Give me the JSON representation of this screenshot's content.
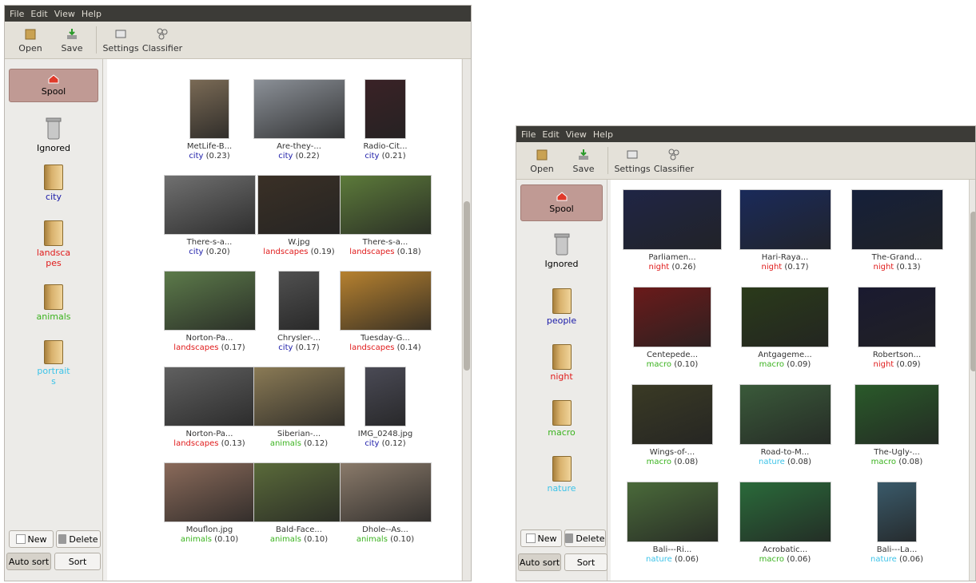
{
  "colors": {
    "city": "#1a1aa8",
    "landscapes": "#e01b1b",
    "animals": "#3bb31f",
    "portraits": "#3cc3e8",
    "people": "#1a1aa8",
    "night": "#e01b1b",
    "macro": "#3bb31f",
    "nature": "#3cc3e8"
  },
  "menu": [
    "File",
    "Edit",
    "View",
    "Help"
  ],
  "toolbar": {
    "open": "Open",
    "save": "Save",
    "settings": "Settings",
    "classifier": "Classifier"
  },
  "buttons": {
    "new": "New",
    "delete": "Delete",
    "auto_sort": "Auto sort",
    "sort": "Sort"
  },
  "left": {
    "sidebar": [
      {
        "label": "Spool",
        "kind": "spool"
      },
      {
        "label": "Ignored",
        "kind": "trash"
      },
      {
        "label": "city",
        "kind": "folder",
        "color": "#1a1aa8"
      },
      {
        "label": "landscapes",
        "kind": "folder",
        "color": "#e01b1b"
      },
      {
        "label": "animals",
        "kind": "folder",
        "color": "#3bb31f"
      },
      {
        "label": "portraits",
        "kind": "folder",
        "color": "#3cc3e8"
      }
    ],
    "items": [
      {
        "name": "MetLife-B...",
        "cat": "city",
        "score": "(0.23)"
      },
      {
        "name": "Are-they-...",
        "cat": "city",
        "score": "(0.22)"
      },
      {
        "name": "Radio-Cit...",
        "cat": "city",
        "score": "(0.21)"
      },
      {
        "name": "There-s-a...",
        "cat": "city",
        "score": "(0.20)"
      },
      {
        "name": "W.jpg",
        "cat": "landscapes",
        "score": "(0.19)"
      },
      {
        "name": "There-s-a...",
        "cat": "landscapes",
        "score": "(0.18)"
      },
      {
        "name": "Norton-Pa...",
        "cat": "landscapes",
        "score": "(0.17)"
      },
      {
        "name": "Chrysler-...",
        "cat": "city",
        "score": "(0.17)"
      },
      {
        "name": "Tuesday-G...",
        "cat": "landscapes",
        "score": "(0.14)"
      },
      {
        "name": "Norton-Pa...",
        "cat": "landscapes",
        "score": "(0.13)"
      },
      {
        "name": "Siberian-...",
        "cat": "animals",
        "score": "(0.12)"
      },
      {
        "name": "IMG_0248.jpg",
        "cat": "city",
        "score": "(0.12)"
      },
      {
        "name": "Mouflon.jpg",
        "cat": "animals",
        "score": "(0.10)"
      },
      {
        "name": "Bald-Face...",
        "cat": "animals",
        "score": "(0.10)"
      },
      {
        "name": "Dhole--As...",
        "cat": "animals",
        "score": "(0.10)"
      }
    ]
  },
  "right": {
    "sidebar": [
      {
        "label": "Spool",
        "kind": "spool"
      },
      {
        "label": "Ignored",
        "kind": "trash"
      },
      {
        "label": "people",
        "kind": "folder",
        "color": "#1a1aa8"
      },
      {
        "label": "night",
        "kind": "folder",
        "color": "#e01b1b"
      },
      {
        "label": "macro",
        "kind": "folder",
        "color": "#3bb31f"
      },
      {
        "label": "nature",
        "kind": "folder",
        "color": "#3cc3e8"
      }
    ],
    "items": [
      {
        "name": "Parliamen...",
        "cat": "night",
        "score": "(0.26)"
      },
      {
        "name": "Hari-Raya...",
        "cat": "night",
        "score": "(0.17)"
      },
      {
        "name": "The-Grand...",
        "cat": "night",
        "score": "(0.13)"
      },
      {
        "name": "Centepede...",
        "cat": "macro",
        "score": "(0.10)"
      },
      {
        "name": "Antgageme...",
        "cat": "macro",
        "score": "(0.09)"
      },
      {
        "name": "Robertson...",
        "cat": "night",
        "score": "(0.09)"
      },
      {
        "name": "Wings-of-...",
        "cat": "macro",
        "score": "(0.08)"
      },
      {
        "name": "Road-to-M...",
        "cat": "nature",
        "score": "(0.08)"
      },
      {
        "name": "The-Ugly-...",
        "cat": "macro",
        "score": "(0.08)"
      },
      {
        "name": "Bali---Ri...",
        "cat": "nature",
        "score": "(0.06)"
      },
      {
        "name": "Acrobatic...",
        "cat": "macro",
        "score": "(0.06)"
      },
      {
        "name": "Bali---La...",
        "cat": "nature",
        "score": "(0.06)"
      }
    ]
  }
}
